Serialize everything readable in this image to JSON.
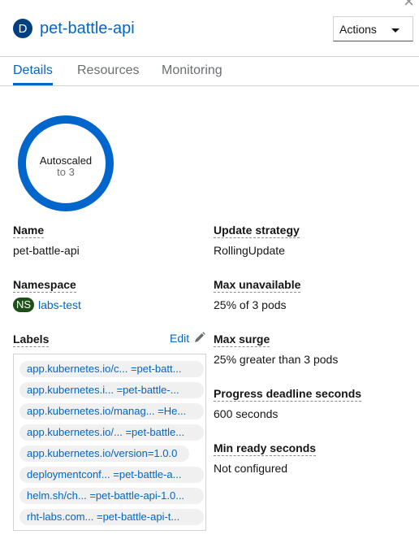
{
  "resource": {
    "badge": "D",
    "name": "pet-battle-api"
  },
  "header": {
    "actions_label": "Actions",
    "close_symbol": "×"
  },
  "tabs": [
    {
      "label": "Details"
    },
    {
      "label": "Resources"
    },
    {
      "label": "Monitoring"
    }
  ],
  "donut": {
    "main": "Autoscaled",
    "sub": "to 3",
    "color": "#0066cc"
  },
  "details_left": {
    "name": {
      "label": "Name",
      "value": "pet-battle-api"
    },
    "namespace": {
      "label": "Namespace",
      "badge": "NS",
      "value": "labs-test"
    },
    "labels": {
      "label": "Labels",
      "edit": "Edit"
    }
  },
  "labels_list": [
    {
      "key": "app.kubernetes.io/c...",
      "value": "=pet-batt..."
    },
    {
      "key": "app.kubernetes.i...",
      "value": "=pet-battle-..."
    },
    {
      "key": "app.kubernetes.io/manag...",
      "value": "=He..."
    },
    {
      "key": "app.kubernetes.io/...",
      "value": "=pet-battle..."
    },
    {
      "key": "app.kubernetes.io/version=1.0.0",
      "value": ""
    },
    {
      "key": "deploymentconf...",
      "value": "=pet-battle-a..."
    },
    {
      "key": "helm.sh/ch...",
      "value": "=pet-battle-api-1.0..."
    },
    {
      "key": "rht-labs.com...",
      "value": "=pet-battle-api-t..."
    }
  ],
  "details_right": {
    "update_strategy": {
      "label": "Update strategy",
      "value": "RollingUpdate"
    },
    "max_unavailable": {
      "label": "Max unavailable",
      "value": "25% of 3 pods"
    },
    "max_surge": {
      "label": "Max surge",
      "value": "25% greater than 3 pods"
    },
    "progress_deadline": {
      "label": "Progress deadline seconds",
      "value": "600 seconds"
    },
    "min_ready": {
      "label": "Min ready seconds",
      "value": "Not configured"
    }
  }
}
